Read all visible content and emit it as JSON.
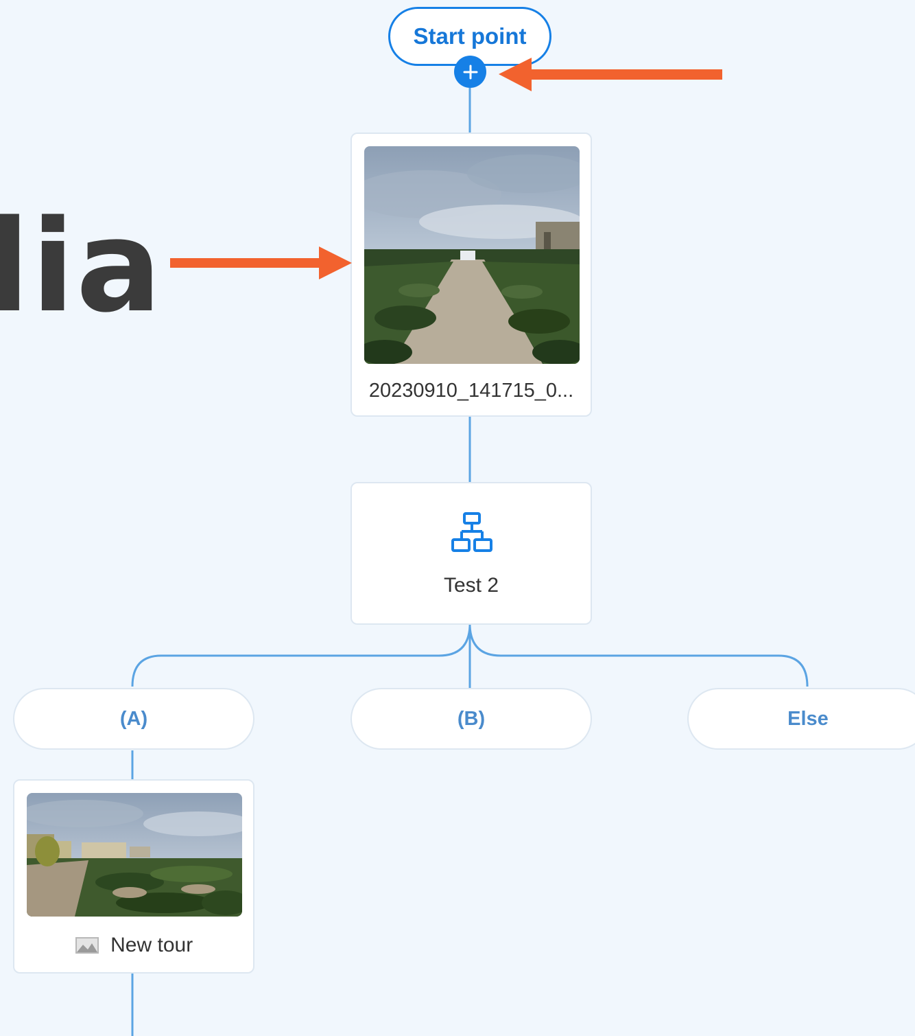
{
  "background_text": "lia",
  "start_node": {
    "label": "Start point"
  },
  "media_card": {
    "label": "20230910_141715_0..."
  },
  "branch_card": {
    "label": "Test 2",
    "icon": "hierarchy-icon"
  },
  "branches": [
    {
      "label": "(A)"
    },
    {
      "label": "(B)"
    },
    {
      "label": "Else"
    }
  ],
  "tour_card": {
    "label": "New tour",
    "icon": "panorama-icon"
  },
  "colors": {
    "background": "#f1f7fd",
    "accent": "#1680e6",
    "connector": "#5ba4e3",
    "annotation_arrow": "#f2622e"
  }
}
